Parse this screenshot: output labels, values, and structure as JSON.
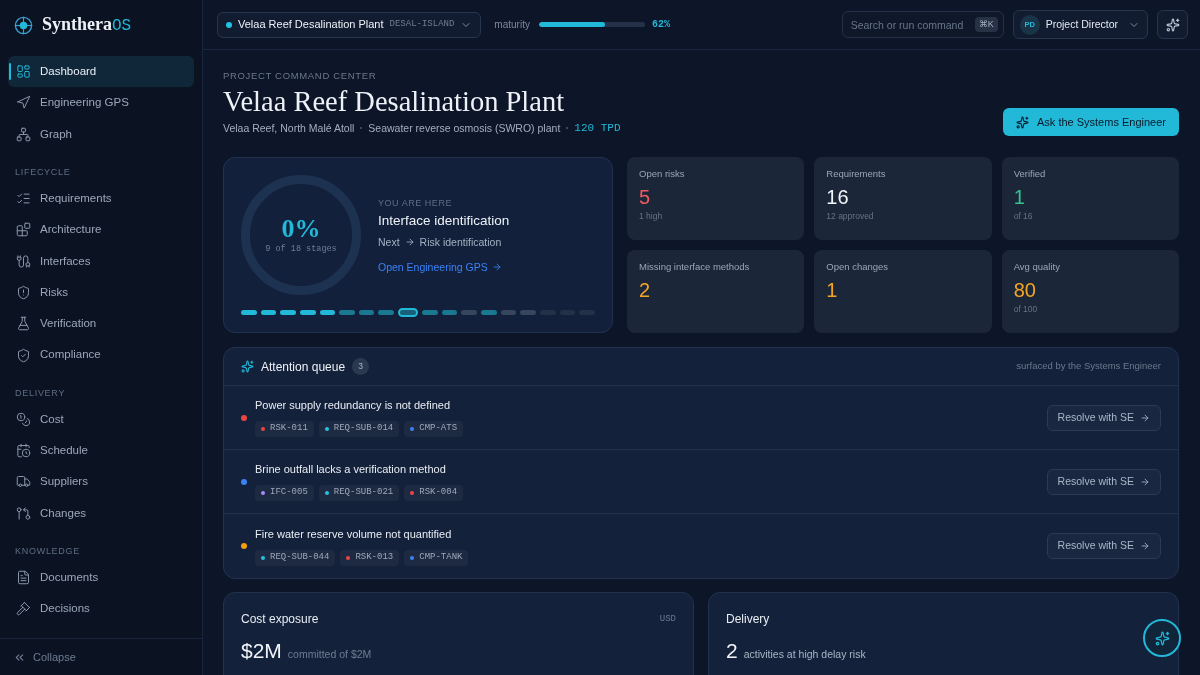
{
  "brand": {
    "name": "Synthera",
    "suffix": "OS"
  },
  "sidebar": {
    "sections": [
      {
        "items": [
          {
            "label": "Dashboard",
            "selected": true
          },
          {
            "label": "Engineering GPS",
            "selected": false
          },
          {
            "label": "Graph",
            "selected": false
          }
        ]
      },
      {
        "title": "LIFECYCLE",
        "items": [
          {
            "label": "Requirements",
            "selected": false
          },
          {
            "label": "Architecture",
            "selected": false
          },
          {
            "label": "Interfaces",
            "selected": false
          },
          {
            "label": "Risks",
            "selected": false
          },
          {
            "label": "Verification",
            "selected": false
          },
          {
            "label": "Compliance",
            "selected": false
          }
        ]
      },
      {
        "title": "DELIVERY",
        "items": [
          {
            "label": "Cost",
            "selected": false
          },
          {
            "label": "Schedule",
            "selected": false
          },
          {
            "label": "Suppliers",
            "selected": false
          },
          {
            "label": "Changes",
            "selected": false
          }
        ]
      },
      {
        "title": "KNOWLEDGE",
        "items": [
          {
            "label": "Documents",
            "selected": false
          },
          {
            "label": "Decisions",
            "selected": false
          }
        ]
      }
    ],
    "collapse": "Collapse"
  },
  "topbar": {
    "project": {
      "name": "Velaa Reef Desalination Plant",
      "code": "DESAL-ISLAND"
    },
    "maturity": {
      "label": "maturity",
      "level": 0.62,
      "reading": "62%"
    },
    "search": {
      "placeholder": "Search or run command",
      "shortcut": "⌘K"
    },
    "user": {
      "initials": "PD",
      "role": "Project Director"
    }
  },
  "header": {
    "eyebrow": "PROJECT COMMAND CENTER",
    "title": "Velaa Reef Desalination Plant",
    "meta": [
      {
        "text": "Velaa Reef, North Malé Atoll",
        "kind": "text"
      },
      {
        "text": "Seawater reverse osmosis (SWRO) plant",
        "kind": "text"
      },
      {
        "text": "120 TPD",
        "kind": "metric"
      }
    ],
    "ask_button": "Ask the Systems Engineer"
  },
  "progress": {
    "percent": "0%",
    "stages": "9 of 18 stages",
    "eyebrow": "YOU ARE HERE",
    "current": "Interface identification",
    "next_label": "Next",
    "next": "Risk identification",
    "link": "Open Engineering GPS",
    "segments": [
      {
        "kind": "done"
      },
      {
        "kind": "done"
      },
      {
        "kind": "done"
      },
      {
        "kind": "done"
      },
      {
        "kind": "done"
      },
      {
        "kind": "active"
      },
      {
        "kind": "active"
      },
      {
        "kind": "active"
      },
      {
        "kind": "current"
      },
      {
        "kind": "active"
      },
      {
        "kind": "active"
      },
      {
        "kind": "pending"
      },
      {
        "kind": "active"
      },
      {
        "kind": "pending"
      },
      {
        "kind": "pending"
      },
      {
        "kind": "locked"
      },
      {
        "kind": "locked"
      },
      {
        "kind": "locked"
      }
    ]
  },
  "stats": [
    {
      "label": "Open risks",
      "value": "5",
      "sub": "1 high",
      "kind": "danger"
    },
    {
      "label": "Requirements",
      "value": "16",
      "sub": "12 approved",
      "kind": "neutral"
    },
    {
      "label": "Verified",
      "value": "1",
      "sub": "of 16",
      "kind": "success"
    },
    {
      "label": "Missing interface methods",
      "value": "2",
      "kind": "warning"
    },
    {
      "label": "Open changes",
      "value": "1",
      "kind": "warning"
    },
    {
      "label": "Avg quality",
      "value": "80",
      "sub": "of 100",
      "kind": "warning"
    }
  ],
  "attention": {
    "title": "Attention queue",
    "count": "3",
    "note": "surfaced by the Systems Engineer",
    "items": [
      {
        "title": "Power supply redundancy is not defined",
        "color": "#ef4444",
        "tags": [
          {
            "code": "RSK-011",
            "color": "#ef4444"
          },
          {
            "code": "REQ-SUB-014",
            "color": "#22c3e0"
          },
          {
            "code": "CMP-ATS",
            "color": "#3b82f6"
          }
        ],
        "action": "Resolve with SE"
      },
      {
        "title": "Brine outfall lacks a verification method",
        "color": "#3b82f6",
        "tags": [
          {
            "code": "IFC-005",
            "color": "#a78bfa"
          },
          {
            "code": "REQ-SUB-021",
            "color": "#22c3e0"
          },
          {
            "code": "RSK-004",
            "color": "#ef4444"
          }
        ],
        "action": "Resolve with SE"
      },
      {
        "title": "Fire water reserve volume not quantified",
        "color": "#f59e0b",
        "tags": [
          {
            "code": "REQ-SUB-044",
            "color": "#22c3e0"
          },
          {
            "code": "RSK-013",
            "color": "#ef4444"
          },
          {
            "code": "CMP-TANK",
            "color": "#3b82f6"
          }
        ],
        "action": "Resolve with SE"
      }
    ]
  },
  "cost": {
    "title": "Cost exposure",
    "unit": "USD",
    "value": "$2M",
    "caption": "committed of $2M"
  },
  "delivery": {
    "title": "Delivery",
    "value": "2",
    "caption": "activities at high delay risk"
  }
}
